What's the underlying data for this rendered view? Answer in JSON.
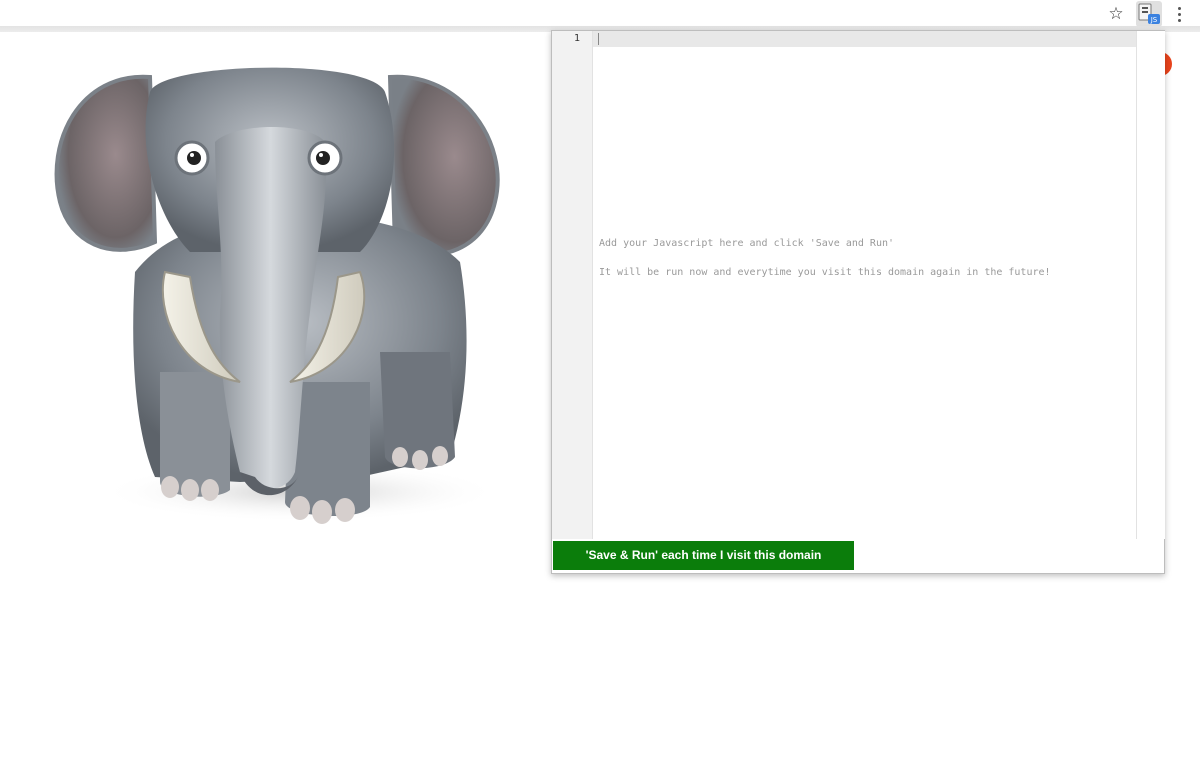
{
  "toolbar": {
    "bookmark_icon": "star-icon",
    "extension_icon": "extension-icon",
    "menu_icon": "vertical-dots-icon"
  },
  "page": {
    "image": "elephant-illustration"
  },
  "popup": {
    "editor": {
      "line_numbers": [
        "1"
      ],
      "placeholder_line_1": "Add your Javascript here and click 'Save and Run'",
      "placeholder_line_2": "It will be run now and everytime you visit this domain again in the future!"
    },
    "save_button_label": "'Save & Run' each time I visit this domain",
    "save_button_color": "#0b7d0b"
  }
}
